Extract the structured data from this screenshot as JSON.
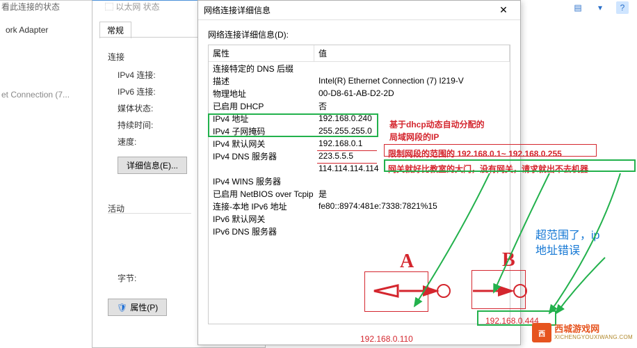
{
  "top_left_label": "看此连接的状态",
  "adapter_label": "ork Adapter",
  "conn_label": "et Connection (7...",
  "status": {
    "tab": "常规",
    "section_conn": "连接",
    "ipv4_conn": "IPv4 连接:",
    "ipv6_conn": "IPv6 连接:",
    "media": "媒体状态:",
    "duration": "持续时间:",
    "speed": "速度:",
    "details_btn": "详细信息(E)...",
    "section_act": "活动",
    "font": "字节:",
    "props_btn": "属性(P)"
  },
  "details": {
    "title": "网络连接详细信息",
    "label": "网络连接详细信息(D):",
    "col1": "属性",
    "col2": "值",
    "rows": [
      {
        "p": "连接特定的 DNS 后缀",
        "v": ""
      },
      {
        "p": "描述",
        "v": "Intel(R) Ethernet Connection (7) I219-V"
      },
      {
        "p": "物理地址",
        "v": "00-D8-61-AB-D2-2D"
      },
      {
        "p": "已启用 DHCP",
        "v": "否"
      },
      {
        "p": "IPv4 地址",
        "v": "192.168.0.240"
      },
      {
        "p": "IPv4 子网掩码",
        "v": "255.255.255.0"
      },
      {
        "p": "IPv4 默认网关",
        "v": "192.168.0.1"
      },
      {
        "p": "IPv4 DNS 服务器",
        "v": "223.5.5.5"
      },
      {
        "p": "",
        "v": "114.114.114.114"
      },
      {
        "p": "IPv4 WINS 服务器",
        "v": ""
      },
      {
        "p": "已启用 NetBIOS over Tcpip",
        "v": "是"
      },
      {
        "p": "连接-本地 IPv6 地址",
        "v": "fe80::8974:481e:7338:7821%15"
      },
      {
        "p": "IPv6 默认网关",
        "v": ""
      },
      {
        "p": "IPv6 DNS 服务器",
        "v": ""
      }
    ]
  },
  "annotations": {
    "dhcp1": "基于dhcp动态自动分配的",
    "dhcp2": "局域网段的IP",
    "range": "限制网段的范围的 192.168.0.1~ 192.168.0.255",
    "gateway": "网关就好比教室的大门，没有网关，请求就出不去机器",
    "outrange1": "超范围了，ip",
    "outrange2": "地址错误",
    "ip_a": "192.168.0.110",
    "ip_b": "192.168.0.444",
    "letter_a": "A",
    "letter_b": "B"
  },
  "watermark": {
    "cn": "西城游戏网",
    "en": "XICHENGYOUXIWANG.COM"
  }
}
